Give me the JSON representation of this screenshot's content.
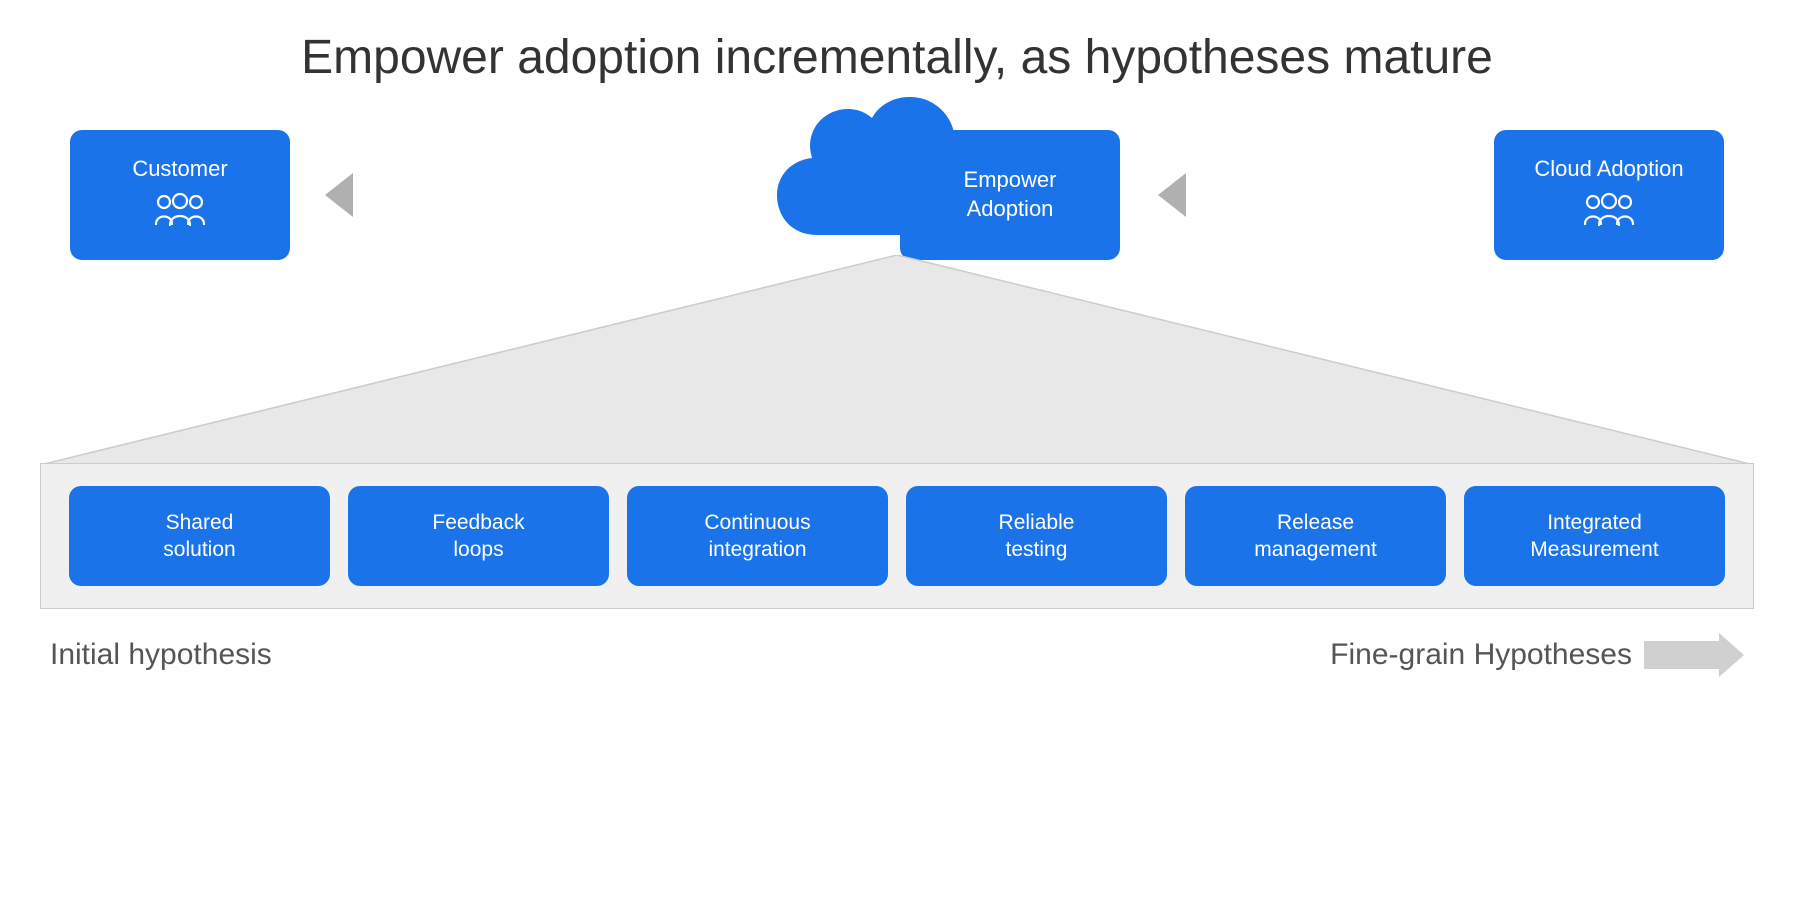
{
  "title": "Empower adoption incrementally, as hypotheses mature",
  "top_boxes": {
    "customer": {
      "label": "Customer",
      "position": "left"
    },
    "empower": {
      "label": "Empower\nAdoption",
      "position": "center-right"
    },
    "cloud_adoption": {
      "label": "Cloud Adoption",
      "position": "right"
    }
  },
  "bottom_boxes": [
    {
      "label": "Shared\nsolution"
    },
    {
      "label": "Feedback\nloops"
    },
    {
      "label": "Continuous\nintegration"
    },
    {
      "label": "Reliable\ntesting"
    },
    {
      "label": "Release\nmanagement"
    },
    {
      "label": "Integrated\nMeasurement"
    }
  ],
  "axis": {
    "left": "Initial hypothesis",
    "right": "Fine-grain Hypotheses"
  }
}
